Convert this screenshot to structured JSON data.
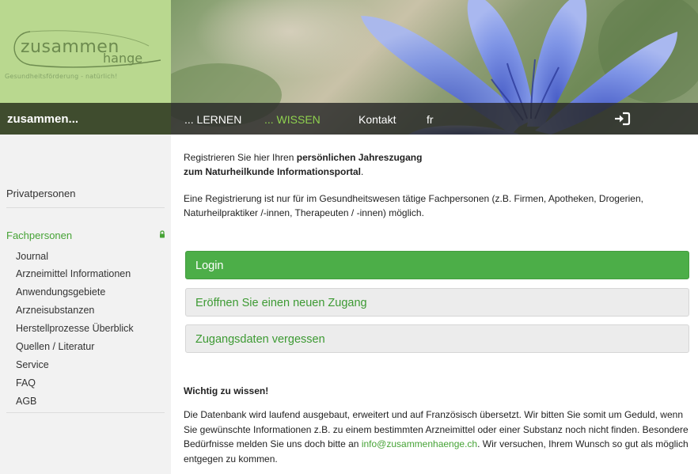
{
  "logo": {
    "line1": "zusammen",
    "line2": "hange",
    "tagline": "Gesundheitsförderung - natürlich!"
  },
  "nav": {
    "brand": "zusammen...",
    "items": [
      {
        "label": "... LERNEN",
        "active": false
      },
      {
        "label": "... WISSEN",
        "active": true
      },
      {
        "label": "Kontakt",
        "active": false
      },
      {
        "label": "fr",
        "active": false
      }
    ],
    "login_icon": "sign-in-icon"
  },
  "sidebar": {
    "privatpersonen": "Privatpersonen",
    "fachpersonen": "Fachpersonen",
    "lock_icon": "lock-icon",
    "items": [
      {
        "label": "Journal"
      },
      {
        "label": "Arzneimittel Informationen"
      },
      {
        "label": "Anwendungsgebiete"
      },
      {
        "label": "Arzneisubstanzen"
      },
      {
        "label": "Herstellprozesse Überblick"
      },
      {
        "label": "Quellen / Literatur"
      },
      {
        "label": "Service"
      },
      {
        "label": "FAQ"
      },
      {
        "label": "AGB"
      }
    ]
  },
  "main": {
    "intro_prefix": "Registrieren Sie hier Ihren ",
    "intro_bold1": "persönlichen Jahreszugang",
    "intro_bold2": "zum Naturheilkunde Informationsportal",
    "intro_suffix": ".",
    "intro2": "Eine Registrierung ist nur für im Gesundheitswesen tätige Fachpersonen (z.B. Firmen, Apotheken, Drogerien, Naturheilpraktiker /-innen, Therapeuten / -innen) möglich.",
    "buttons": {
      "login": "Login",
      "register": "Eröffnen Sie einen neuen Zugang",
      "forgot": "Zugangsdaten vergessen"
    },
    "wichtig_title": "Wichtig zu wissen!",
    "info_text1": "Die Datenbank wird laufend ausgebaut, erweitert und auf Französisch übersetzt. Wir bitten Sie somit um Geduld, wenn Sie gewünschte Informationen z.B. zu einem bestimmten Arzneimittel oder einer Substanz noch nicht finden. Besondere Bedürfnisse melden Sie uns doch bitte an ",
    "info_email": "info@zusammenhaenge.ch",
    "info_text2": ". Wir versuchen, Ihrem Wunsch so gut als möglich entgegen zu kommen."
  },
  "colors": {
    "accent_green": "#4cae48",
    "link_green": "#46a336",
    "logo_bg": "#b9d88f",
    "sidebar_bg": "#f2f2f2"
  }
}
